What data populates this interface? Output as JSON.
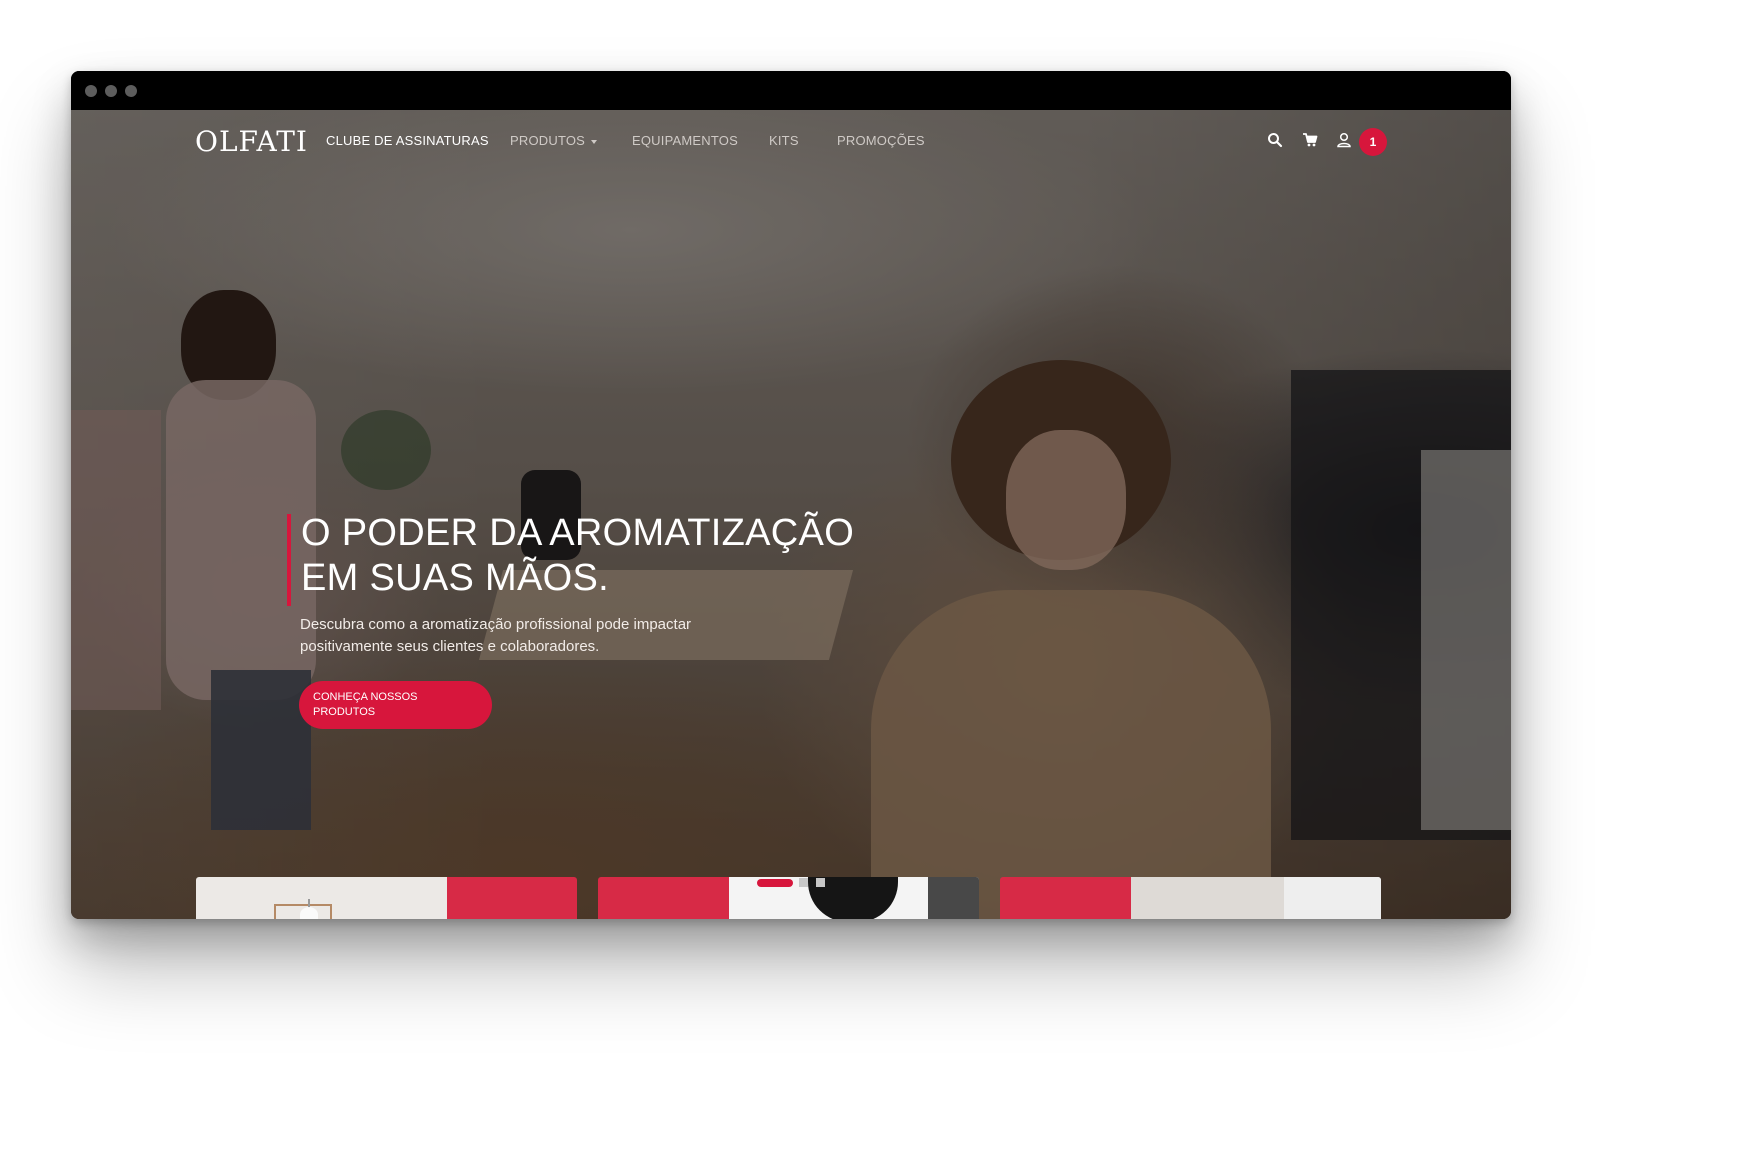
{
  "brand": {
    "logo_text": "OLFATI",
    "accent_color": "#d7163c"
  },
  "nav": {
    "items": [
      {
        "label": "CLUBE DE ASSINATURAS",
        "active": true
      },
      {
        "label": "PRODUTOS",
        "dropdown": true
      },
      {
        "label": "EQUIPAMENTOS"
      },
      {
        "label": "KITS"
      },
      {
        "label": "PROMOÇÕES"
      }
    ],
    "icons": [
      "search-icon",
      "cart-icon",
      "user-icon"
    ],
    "badge_count": "1"
  },
  "hero": {
    "headline": "O PODER DA AROMATIZAÇÃO EM SUAS MÃOS.",
    "subtitle": "Descubra como a aromatização profissional pode impactar positivamente seus clientes e colaboradores.",
    "cta_label": "CONHEÇA NOSSOS PRODUTOS"
  },
  "slider": {
    "slide_count": 3,
    "active_index": 0
  }
}
